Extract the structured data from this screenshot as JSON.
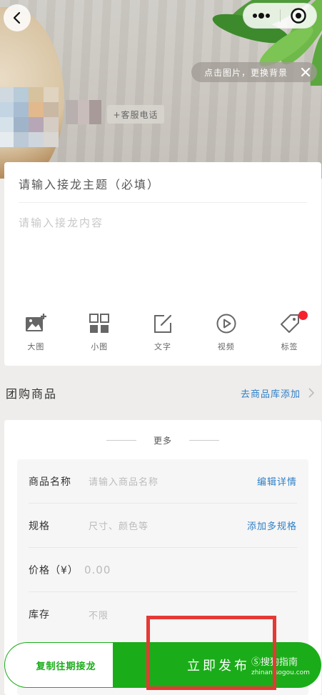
{
  "header": {
    "change_bg_label": "点击图片，更换背景",
    "service_phone_label": "+客服电话"
  },
  "editor": {
    "title_placeholder": "请输入接龙主题（必填）",
    "content_placeholder": "请输入接龙内容",
    "tools": [
      {
        "icon": "large-image-icon",
        "label": "大图"
      },
      {
        "icon": "small-grid-icon",
        "label": "小图"
      },
      {
        "icon": "edit-text-icon",
        "label": "文字"
      },
      {
        "icon": "video-play-icon",
        "label": "视频"
      },
      {
        "icon": "tag-icon",
        "label": "标签"
      }
    ]
  },
  "group_buy": {
    "title": "团购商品",
    "add_link": "去商品库添加"
  },
  "product": {
    "more_label": "更多",
    "rows": [
      {
        "label": "商品名称",
        "placeholder": "请输入商品名称",
        "link": "编辑详情"
      },
      {
        "label": "规格",
        "placeholder": "尺寸、颜色等",
        "link": "添加多规格"
      },
      {
        "label": "价格（¥）",
        "placeholder": "0.00",
        "link": ""
      },
      {
        "label": "库存",
        "placeholder": "不限",
        "link": ""
      }
    ]
  },
  "bottom": {
    "copy_label": "复制往期接龙",
    "publish_label": "立即发布"
  },
  "watermark": {
    "brand": "Ⓢ搜狗指南",
    "domain": "zhinan.sogou.com"
  },
  "colors": {
    "accent_green": "#1aad19",
    "link_blue": "#2e7fc7",
    "badge_red": "#f5222d",
    "highlight_red": "#e53935"
  }
}
